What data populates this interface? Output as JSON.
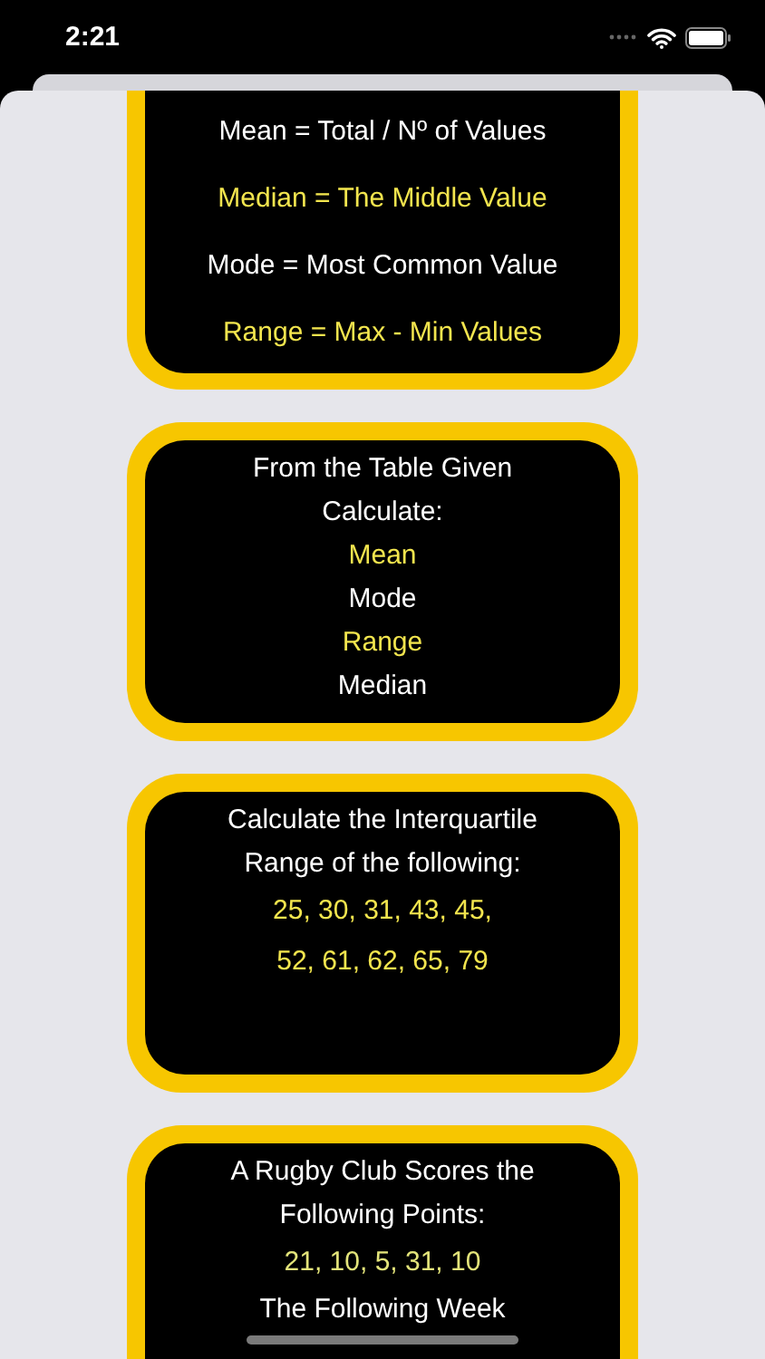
{
  "status_bar": {
    "time": "2:21"
  },
  "cards": [
    {
      "cut_top": true,
      "lines": [
        {
          "kind": "formula",
          "text": "Mean = Total / Nº of Values",
          "color": "#ffffff"
        },
        {
          "kind": "formula",
          "text": "Median = The Middle Value",
          "color": "#f2e54e"
        },
        {
          "kind": "formula",
          "text": "Mode = Most Common Value",
          "color": "#ffffff"
        },
        {
          "kind": "formula",
          "text": "Range = Max - Min Values",
          "color": "#f2e54e"
        }
      ]
    },
    {
      "cut_top": false,
      "lines": [
        {
          "kind": "title",
          "text": "From the Table Given",
          "color": "#ffffff"
        },
        {
          "kind": "title",
          "text": "Calculate:",
          "color": "#ffffff"
        },
        {
          "kind": "title",
          "text": "Mean",
          "color": "#f2e54e"
        },
        {
          "kind": "title",
          "text": "Mode",
          "color": "#ffffff"
        },
        {
          "kind": "title",
          "text": "Range",
          "color": "#f2e54e"
        },
        {
          "kind": "title",
          "text": "Median",
          "color": "#ffffff"
        }
      ]
    },
    {
      "cut_top": false,
      "lines": [
        {
          "kind": "title",
          "text": "Calculate the Interquartile",
          "color": "#ffffff"
        },
        {
          "kind": "title",
          "text": "Range of the following:",
          "color": "#ffffff"
        },
        {
          "kind": "values",
          "text": "25, 30, 31, 43, 45,",
          "color": "#f2e54e"
        },
        {
          "kind": "values",
          "text": "52, 61, 62, 65, 79",
          "color": "#f2e54e"
        }
      ]
    },
    {
      "cut_top": false,
      "lines": [
        {
          "kind": "title",
          "text": "A Rugby Club Scores the",
          "color": "#ffffff"
        },
        {
          "kind": "title",
          "text": "Following Points:",
          "color": "#ffffff"
        },
        {
          "kind": "values",
          "text": "21, 10, 5, 31, 10",
          "color": "#e3e47a"
        },
        {
          "kind": "title",
          "text": "The Following Week",
          "color": "#ffffff"
        }
      ]
    }
  ]
}
